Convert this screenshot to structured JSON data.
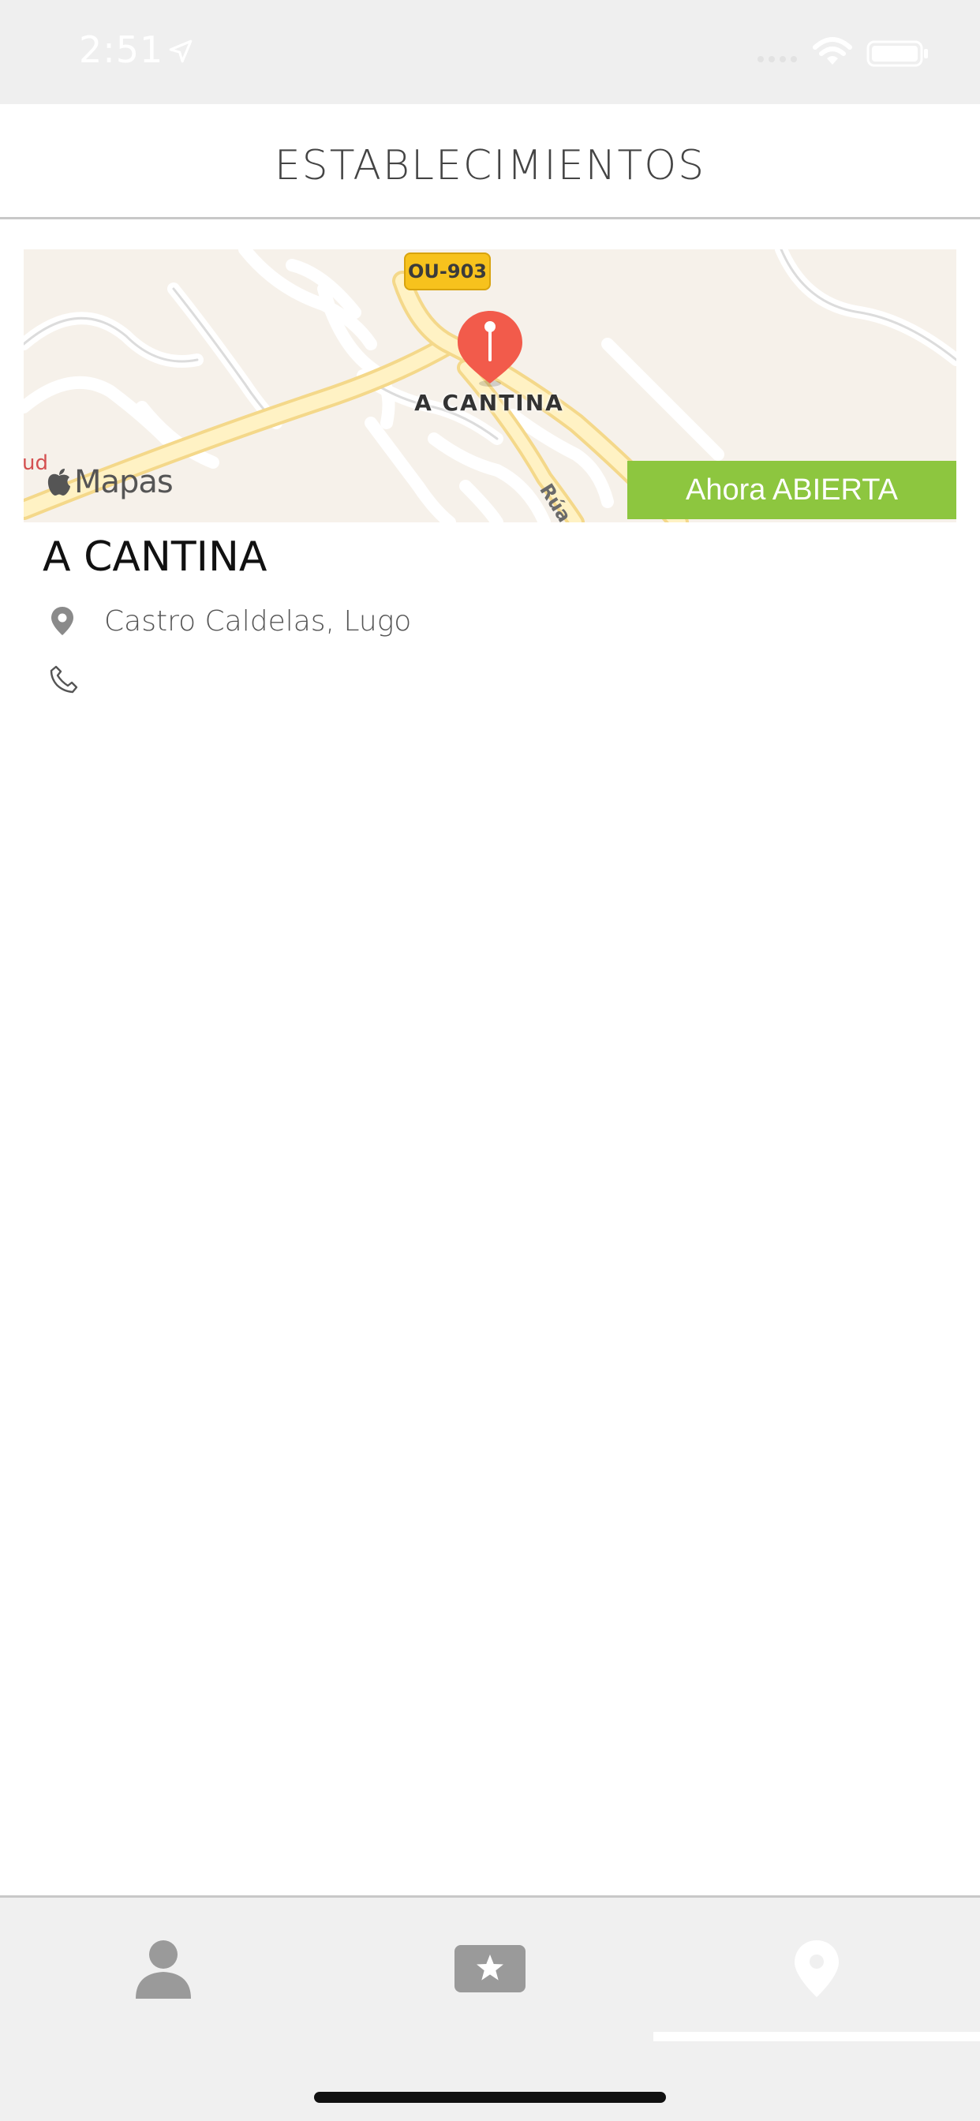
{
  "status_bar": {
    "time": "2:51",
    "icons": [
      "location-arrow-icon",
      "signal-icon",
      "wifi-icon",
      "battery-icon"
    ]
  },
  "header": {
    "title": "ESTABLECIMIENTOS"
  },
  "map": {
    "road_shield": "OU-903",
    "place_label": "A CANTINA",
    "street_label": "Rúa L",
    "edge_label": "ud",
    "logo_text": "Mapas",
    "badge": "Ahora ABIERTA"
  },
  "establishment": {
    "name": "A CANTINA",
    "address": "Castro Caldelas, Lugo",
    "phone": ""
  },
  "tab_bar": {
    "tabs": [
      {
        "icon": "person-icon",
        "active": false
      },
      {
        "icon": "star-ticket-icon",
        "active": false
      },
      {
        "icon": "map-pin-icon",
        "active": true
      }
    ]
  },
  "colors": {
    "badge_green": "#8dc63f",
    "pin_red": "#f25b4b",
    "shield_yellow": "#f7c21d",
    "map_background": "#f6f1ea"
  }
}
